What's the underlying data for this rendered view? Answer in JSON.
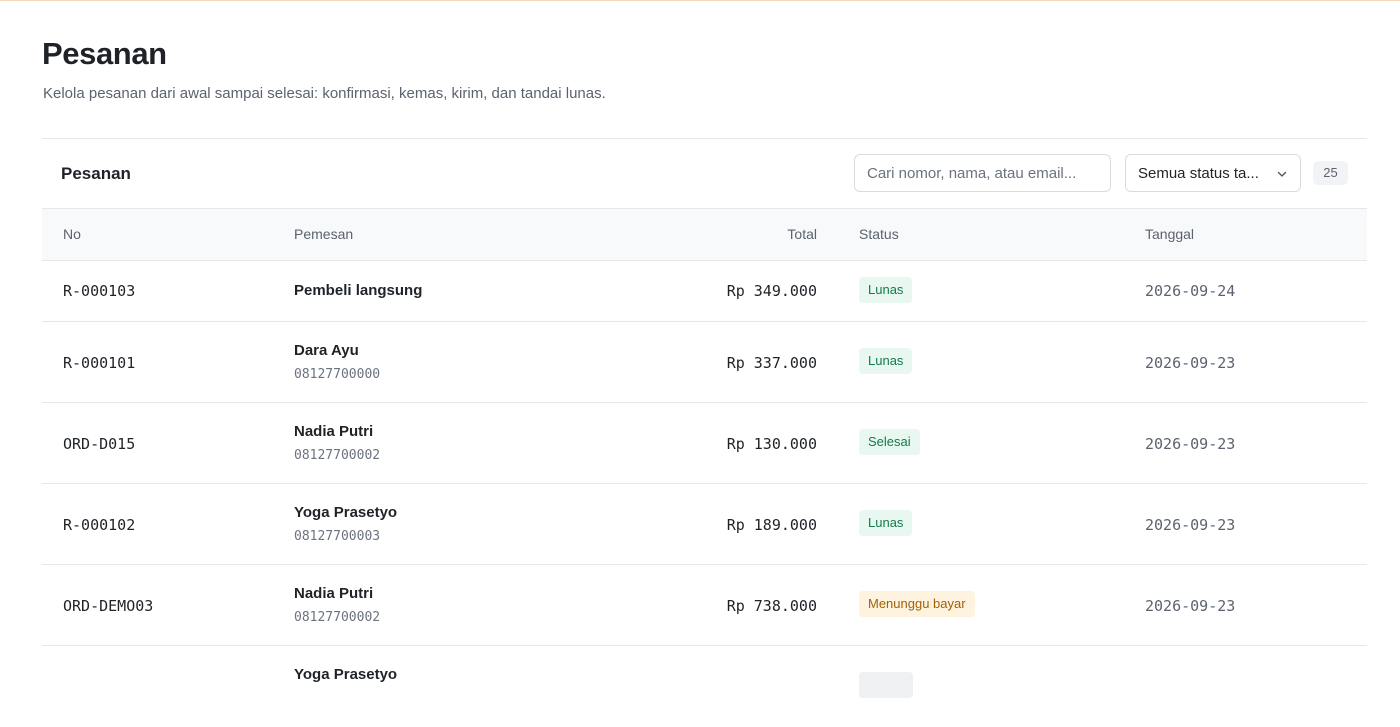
{
  "page": {
    "title": "Pesanan",
    "subtitle": "Kelola pesanan dari awal sampai selesai: konfirmasi, kemas, kirim, dan tandai lunas."
  },
  "card": {
    "title": "Pesanan",
    "search_placeholder": "Cari nomor, nama, atau email...",
    "status_filter": "Semua status ta...",
    "count": "25"
  },
  "table": {
    "columns": {
      "no": "No",
      "customer": "Pemesan",
      "total": "Total",
      "status": "Status",
      "date": "Tanggal"
    },
    "rows": [
      {
        "no": "R-000103",
        "name": "Pembeli langsung",
        "phone": "",
        "total": "Rp 349.000",
        "status": "Lunas",
        "status_tone": "green",
        "date": "2026-09-24"
      },
      {
        "no": "R-000101",
        "name": "Dara Ayu",
        "phone": "08127700000",
        "total": "Rp 337.000",
        "status": "Lunas",
        "status_tone": "green",
        "date": "2026-09-23"
      },
      {
        "no": "ORD-D015",
        "name": "Nadia Putri",
        "phone": "08127700002",
        "total": "Rp 130.000",
        "status": "Selesai",
        "status_tone": "green",
        "date": "2026-09-23"
      },
      {
        "no": "R-000102",
        "name": "Yoga Prasetyo",
        "phone": "08127700003",
        "total": "Rp 189.000",
        "status": "Lunas",
        "status_tone": "green",
        "date": "2026-09-23"
      },
      {
        "no": "ORD-DEMO03",
        "name": "Nadia Putri",
        "phone": "08127700002",
        "total": "Rp 738.000",
        "status": "Menunggu bayar",
        "status_tone": "amber",
        "date": "2026-09-23"
      },
      {
        "no": "",
        "name": "Yoga Prasetyo",
        "phone": "",
        "total": "",
        "status": "",
        "status_tone": "gray",
        "date": ""
      }
    ]
  },
  "colors": {
    "accent_top": "#f3d9b8",
    "status_green_bg": "#e8f7ef",
    "status_green_fg": "#137a4b",
    "status_amber_bg": "#fdf3df",
    "status_amber_fg": "#a1620a"
  },
  "icons": {
    "status_select_chevron": "chevron-down-icon"
  }
}
